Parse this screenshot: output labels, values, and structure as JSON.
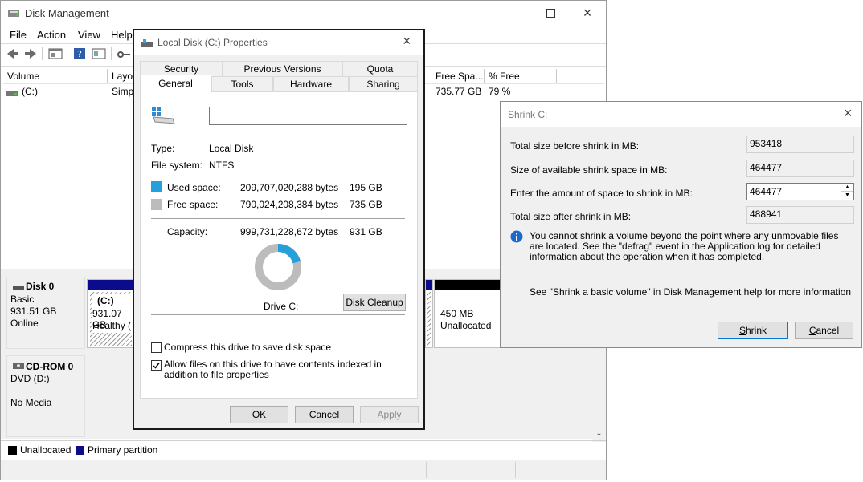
{
  "main": {
    "title": "Disk Management",
    "menu": [
      "File",
      "Action",
      "View",
      "Help"
    ],
    "columns": [
      "Volume",
      "Layout",
      "Free Spa...",
      "% Free"
    ],
    "volume_row": {
      "name": "(C:)",
      "layout": "Simp",
      "free": "735.77 GB",
      "pct": "79 %"
    },
    "disk0": {
      "name": "Disk 0",
      "type": "Basic",
      "size": "931.51 GB",
      "status": "Online"
    },
    "disk0_part": {
      "label": "(C:)",
      "size": "931.07 GB",
      "status": "Healthy ("
    },
    "disk0_unalloc": {
      "size": "450 MB",
      "status": "Unallocated"
    },
    "cdrom": {
      "name": "CD-ROM 0",
      "type": "DVD (D:)",
      "media": "No Media"
    },
    "legend": [
      "Unallocated",
      "Primary partition"
    ]
  },
  "props": {
    "title": "Local Disk (C:) Properties",
    "tabs_row1": [
      "Security",
      "Previous Versions",
      "Quota"
    ],
    "tabs_row2": [
      "General",
      "Tools",
      "Hardware",
      "Sharing"
    ],
    "name_value": "",
    "type_label": "Type:",
    "type_value": "Local Disk",
    "fs_label": "File system:",
    "fs_value": "NTFS",
    "used_label": "Used space:",
    "used_bytes": "209,707,020,288 bytes",
    "used_gb": "195 GB",
    "free_label": "Free space:",
    "free_bytes": "790,024,208,384 bytes",
    "free_gb": "735 GB",
    "cap_label": "Capacity:",
    "cap_bytes": "999,731,228,672 bytes",
    "cap_gb": "931 GB",
    "used_fraction": 0.21,
    "drive_label": "Drive C:",
    "cleanup_btn": "Disk Cleanup",
    "compress_label": "Compress this drive to save disk space",
    "compress_checked": false,
    "index_label": "Allow files on this drive to have contents indexed in addition to file properties",
    "index_checked": true,
    "ok": "OK",
    "cancel": "Cancel",
    "apply": "Apply",
    "colors": {
      "used": "#26a0da",
      "free": "#bcbcbc"
    }
  },
  "shrink": {
    "title": "Shrink C:",
    "total_before_label": "Total size before shrink in MB:",
    "total_before": "953418",
    "available_label": "Size of available shrink space in MB:",
    "available": "464477",
    "amount_label": "Enter the amount of space to shrink in MB:",
    "amount": "464477",
    "after_label": "Total size after shrink in MB:",
    "after": "488941",
    "info": "You cannot shrink a volume beyond the point where any unmovable files are located. See the \"defrag\" event in the Application log for detailed information about the operation when it has completed.",
    "help": "See \"Shrink a basic volume\" in Disk Management help for more information",
    "shrink_btn": "Shrink",
    "cancel_btn": "Cancel"
  }
}
